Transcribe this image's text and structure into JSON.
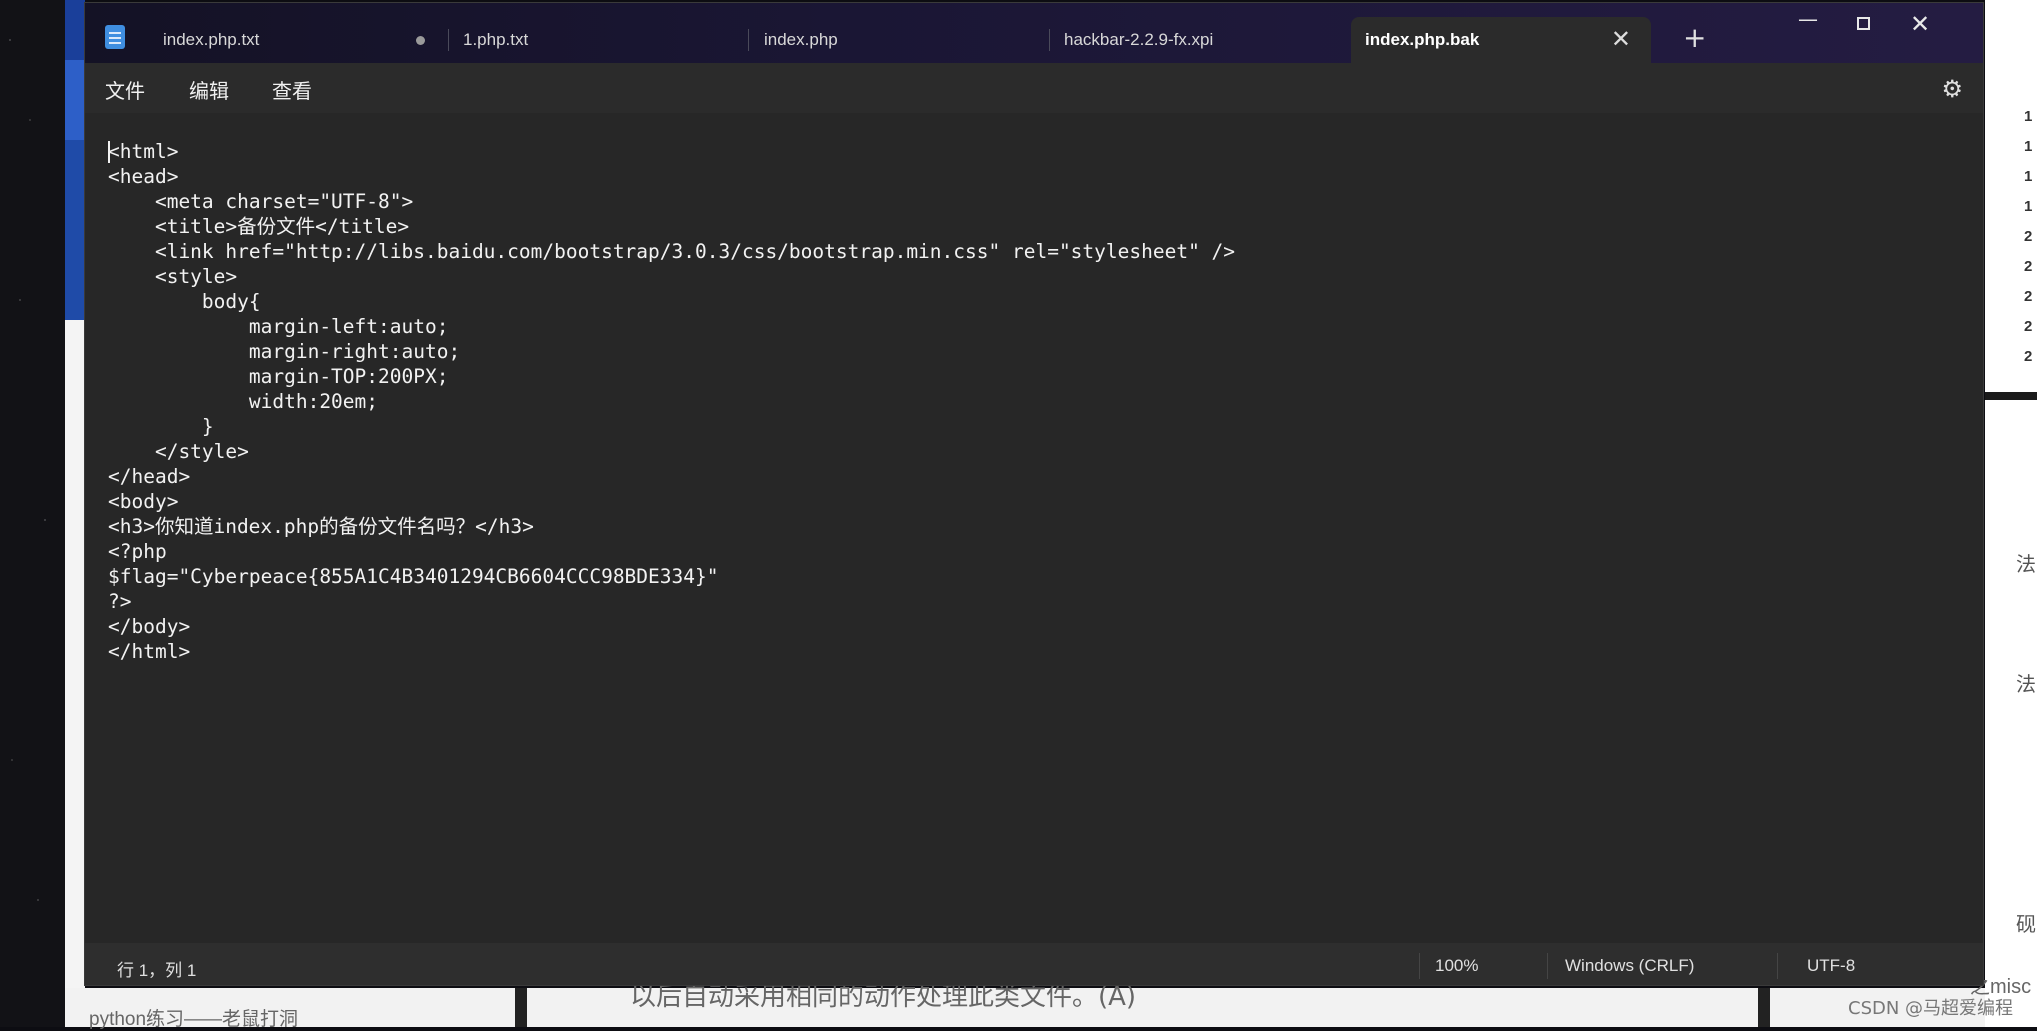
{
  "background": {
    "right_panel_numbers": [
      "1",
      "1",
      "1",
      "1",
      "2",
      "2",
      "2",
      "2",
      "2"
    ],
    "right_panel_fragments": [
      "法",
      "法",
      "砚"
    ],
    "bottom_left_text": "python练习——老鼠打洞",
    "dialog_text": "以后自动采用相同的动作处理此类文件。(A)",
    "bottom_right_text": "之misc",
    "watermark": "CSDN @马超爱编程"
  },
  "tabs": [
    {
      "label": "index.php.txt",
      "modified": true
    },
    {
      "label": "1.php.txt"
    },
    {
      "label": "index.php"
    },
    {
      "label": "hackbar-2.2.9-fx.xpi"
    },
    {
      "label": "index.php.bak",
      "active": true
    }
  ],
  "titlebar": {
    "new_tab": "+",
    "minimize": "—",
    "close": "✕",
    "tab_close": "✕"
  },
  "menu": {
    "file": "文件",
    "edit": "编辑",
    "view": "查看",
    "settings_icon": "⚙"
  },
  "editor": {
    "content": "<html>\n<head>\n    <meta charset=\"UTF-8\">\n    <title>备份文件</title>\n    <link href=\"http://libs.baidu.com/bootstrap/3.0.3/css/bootstrap.min.css\" rel=\"stylesheet\" />\n    <style>\n        body{\n            margin-left:auto;\n            margin-right:auto;\n            margin-TOP:200PX;\n            width:20em;\n        }\n    </style>\n</head>\n<body>\n<h3>你知道index.php的备份文件名吗？</h3>\n<?php\n$flag=\"Cyberpeace{855A1C4B3401294CB6604CCC98BDE334}\"\n?>\n</body>\n</html>"
  },
  "status": {
    "position": "行 1，列 1",
    "zoom": "100%",
    "line_ending": "Windows (CRLF)",
    "encoding": "UTF-8"
  }
}
